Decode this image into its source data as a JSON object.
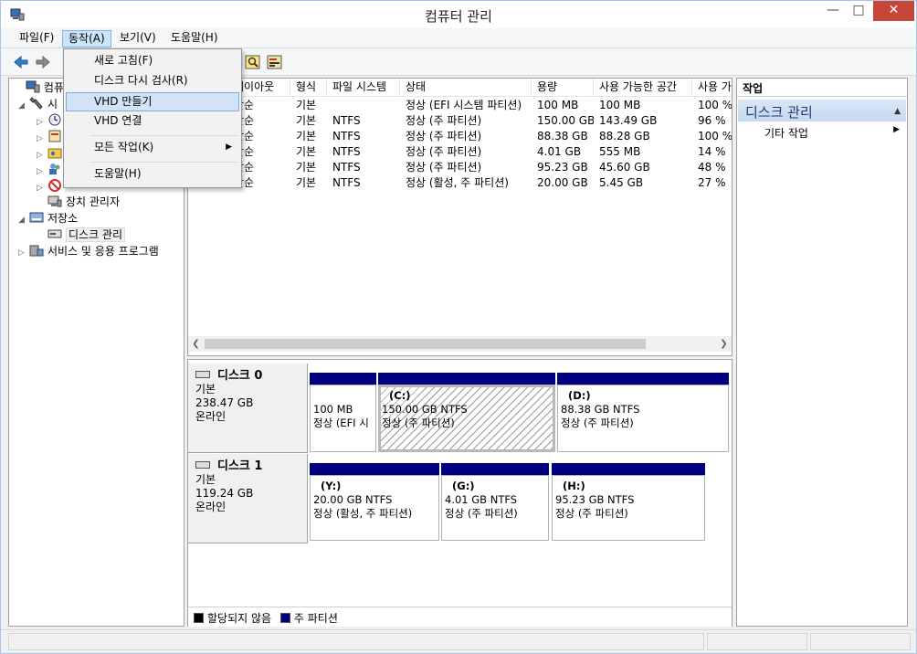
{
  "window": {
    "title": "컴퓨터 관리"
  },
  "menubar": {
    "file": "파일(F)",
    "action": "동작(A)",
    "view": "보기(V)",
    "help": "도움말(H)"
  },
  "action_menu": {
    "refresh": "새로 고침(F)",
    "rescan": "디스크 다시 검사(R)",
    "create_vhd": "VHD 만들기",
    "attach_vhd": "VHD 연결",
    "all_tasks": "모든 작업(K)",
    "help": "도움말(H)"
  },
  "tree": {
    "root": "컴퓨터 관리 (로컬)",
    "root_visible": "컴퓨터",
    "system_tools": "시스템 도구",
    "system_tools_visible": "시",
    "device_manager": "장치 관리자",
    "storage": "저장소",
    "disk_management": "디스크 관리",
    "services": "서비스 및 응용 프로그램"
  },
  "volume_list": {
    "columns": [
      "레이아웃",
      "형식",
      "파일 시스템",
      "상태",
      "용량",
      "사용 가능한 공간",
      "사용 가"
    ],
    "rows": [
      [
        "단순",
        "기본",
        "",
        "정상 (EFI 시스템 파티션)",
        "100 MB",
        "100 MB",
        "100 %"
      ],
      [
        "단순",
        "기본",
        "NTFS",
        "정상 (주 파티션)",
        "150.00 GB",
        "143.49 GB",
        "96 %"
      ],
      [
        "단순",
        "기본",
        "NTFS",
        "정상 (주 파티션)",
        "88.38 GB",
        "88.28 GB",
        "100 %"
      ],
      [
        "단순",
        "기본",
        "NTFS",
        "정상 (주 파티션)",
        "4.01 GB",
        "555 MB",
        "14 %"
      ],
      [
        "단순",
        "기본",
        "NTFS",
        "정상 (주 파티션)",
        "95.23 GB",
        "45.60 GB",
        "48 %"
      ],
      [
        "단순",
        "기본",
        "NTFS",
        "정상 (활성, 주 파티션)",
        "20.00 GB",
        "5.45 GB",
        "27 %"
      ]
    ]
  },
  "disks": [
    {
      "name": "디스크 0",
      "type": "기본",
      "size": "238.47 GB",
      "status": "온라인",
      "partitions": [
        {
          "label": "",
          "size": "100 MB",
          "status": "정상 (EFI 시"
        },
        {
          "label": "(C:)",
          "size": "150.00 GB NTFS",
          "status": "정상 (주 파티션)"
        },
        {
          "label": "(D:)",
          "size": "88.38 GB NTFS",
          "status": "정상 (주 파티션)"
        }
      ]
    },
    {
      "name": "디스크 1",
      "type": "기본",
      "size": "119.24 GB",
      "status": "온라인",
      "partitions": [
        {
          "label": "(Y:)",
          "size": "20.00 GB NTFS",
          "status": "정상 (활성, 주 파티션)"
        },
        {
          "label": "(G:)",
          "size": "4.01 GB NTFS",
          "status": "정상 (주 파티션)"
        },
        {
          "label": "(H:)",
          "size": "95.23 GB NTFS",
          "status": "정상 (주 파티션)"
        }
      ]
    }
  ],
  "legend": {
    "unallocated": "할당되지 않음",
    "primary": "주 파티션"
  },
  "actions_pane": {
    "header": "작업",
    "section": "디스크 관리",
    "more": "기타 작업"
  },
  "colors": {
    "primary_partition": "#000080",
    "unallocated": "#000000",
    "close_button": "#c7463a"
  }
}
